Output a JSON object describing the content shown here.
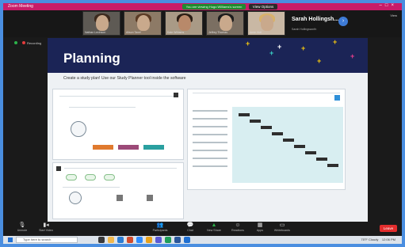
{
  "window": {
    "app_name": "Zoom Meeting",
    "share_status": "You are viewing Hugo Williams's screen",
    "view_options_label": "View Options",
    "view_button": "View"
  },
  "participants": [
    {
      "name": "Nathan Levinson"
    },
    {
      "name": "Alison Tavel"
    },
    {
      "name": "Kate Williams"
    },
    {
      "name": "Jeffrey Thomas"
    },
    {
      "name": "Amie Holt"
    }
  ],
  "active_speaker": {
    "name": "Sarah Hollingsh...",
    "subtitle": "Sarah Hollingsworth"
  },
  "recording": {
    "label": "Recording"
  },
  "slide": {
    "title": "Planning",
    "text": "Create a study plan! Use our Study Planner tool inside the software",
    "spark_colors": [
      "#f6c90e",
      "#39d0c6",
      "#ffffff",
      "#e83e8c"
    ]
  },
  "controls": {
    "items": [
      {
        "label": "Unmute",
        "icon": "microphone-icon"
      },
      {
        "label": "Start Video",
        "icon": "video-icon"
      },
      {
        "label": "Participants",
        "icon": "people-icon"
      },
      {
        "label": "Chat",
        "icon": "chat-icon"
      },
      {
        "label": "New Share",
        "icon": "share-icon"
      },
      {
        "label": "Reactions",
        "icon": "reaction-icon"
      },
      {
        "label": "Apps",
        "icon": "apps-icon"
      },
      {
        "label": "Whiteboards",
        "icon": "whiteboard-icon"
      }
    ],
    "leave_label": "Leave"
  },
  "taskbar": {
    "search_placeholder": "Type here to search",
    "weather": "75°F Cloudy",
    "time": "12:06 PM"
  }
}
